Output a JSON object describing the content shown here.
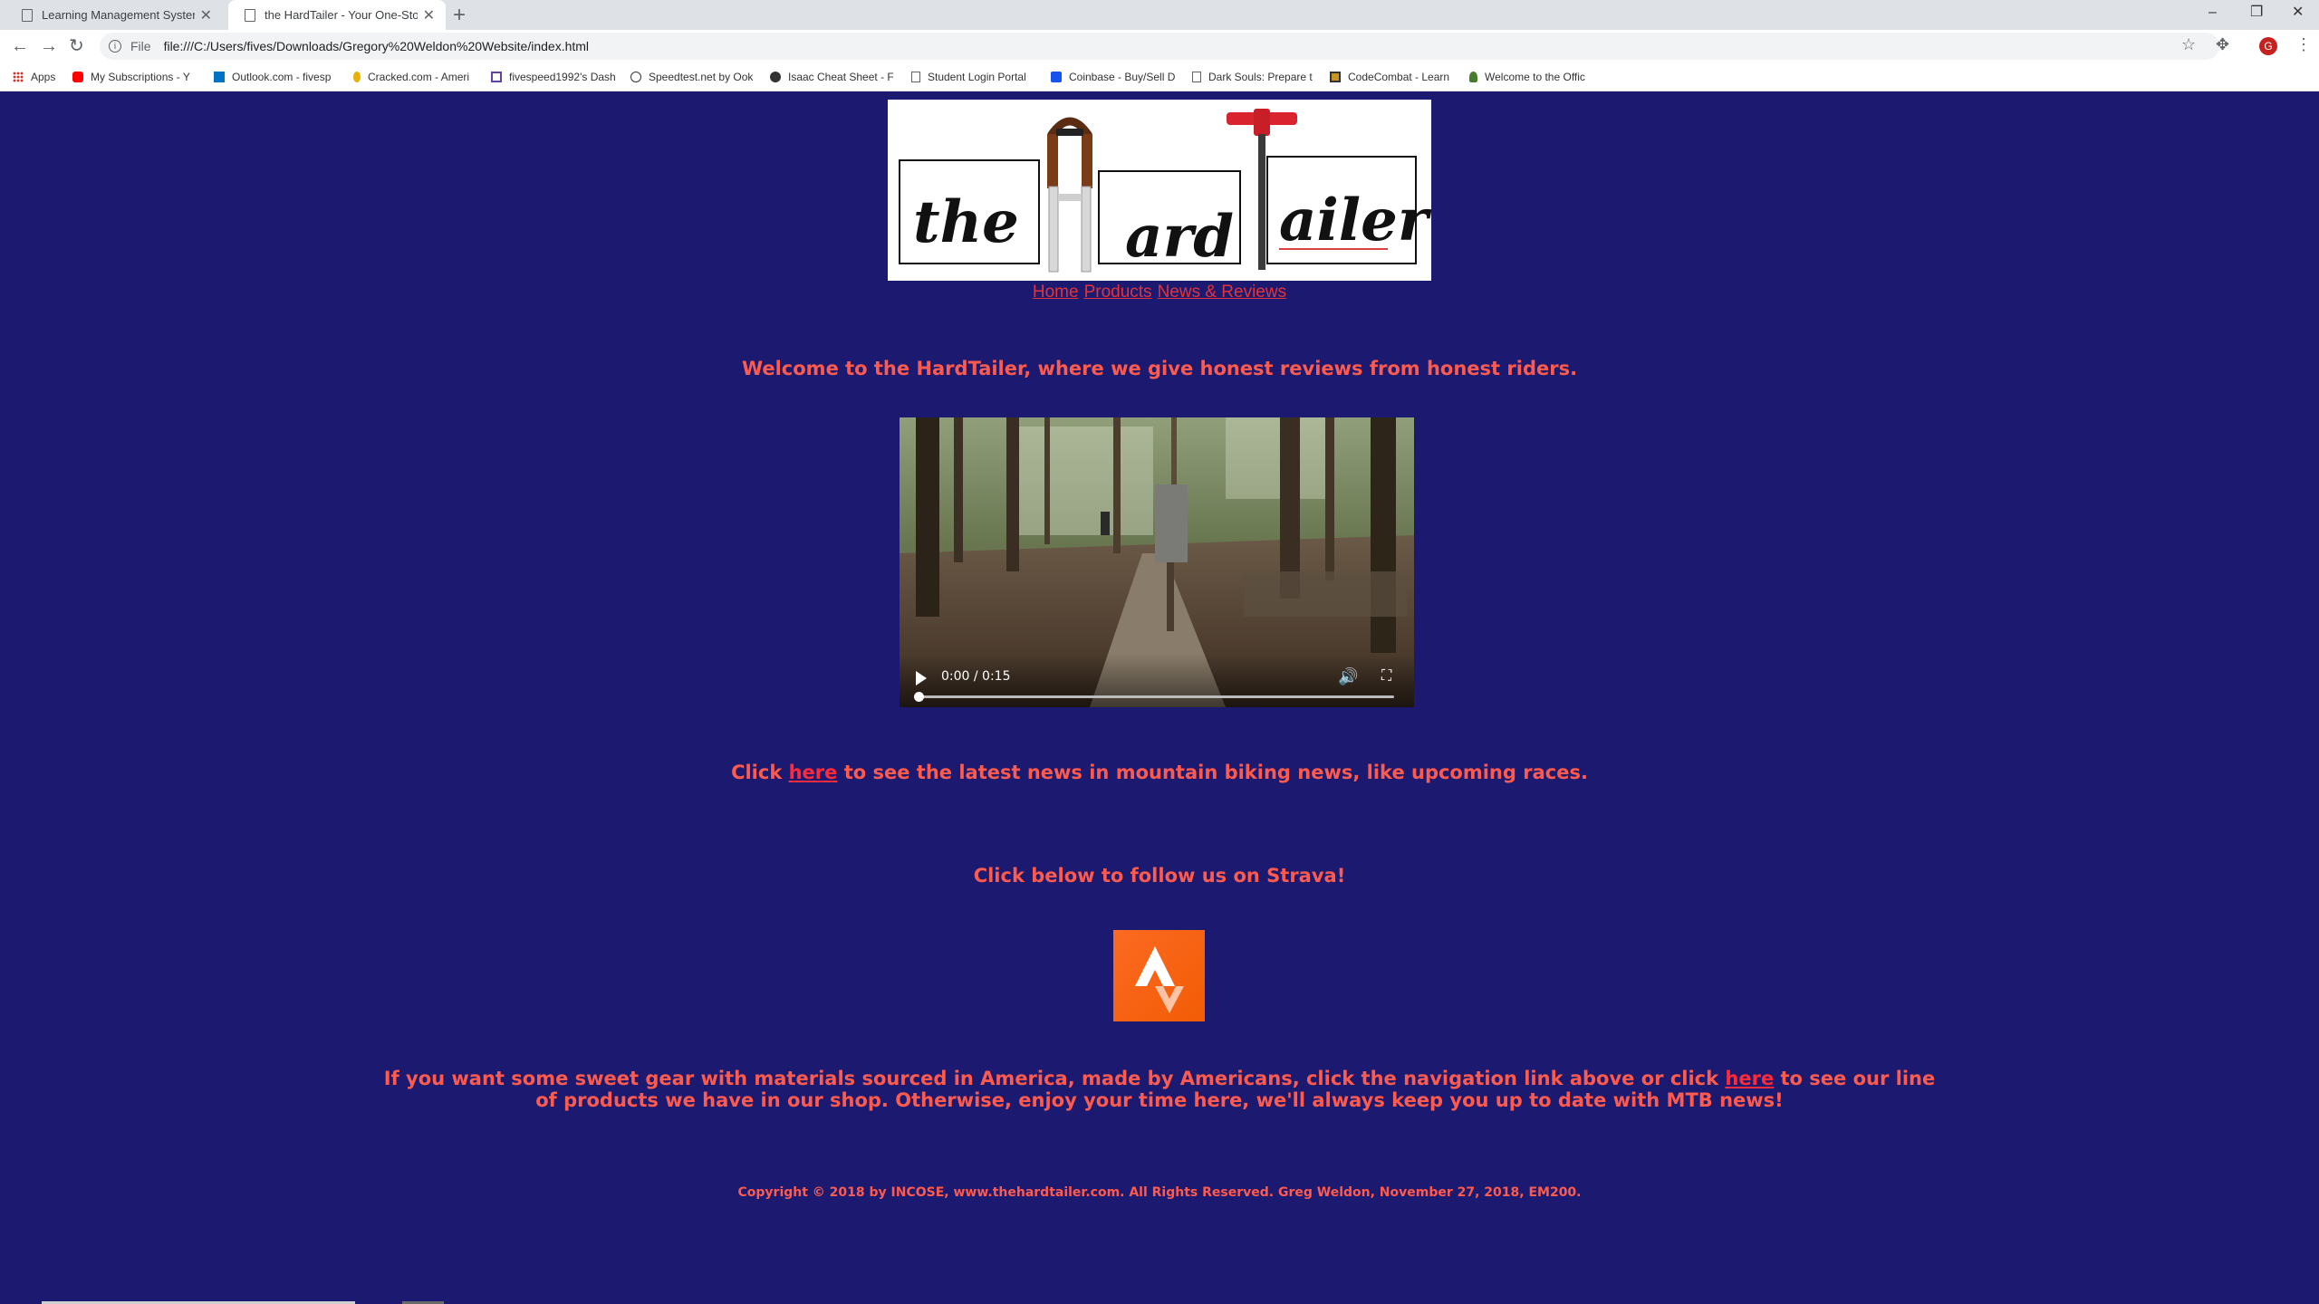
{
  "browser": {
    "tabs": [
      {
        "title": "Learning Management System",
        "active": false
      },
      {
        "title": "the HardTailer - Your One-Stop S",
        "active": true
      }
    ],
    "address": {
      "scheme": "File",
      "url": "file:///C:/Users/fives/Downloads/Gregory%20Weldon%20Website/index.html"
    },
    "profile_initial": "G",
    "bookmarks": [
      {
        "label": "Apps",
        "icon": "apps-grid-icon"
      },
      {
        "label": "My Subscriptions - Y",
        "icon": "youtube-icon"
      },
      {
        "label": "Outlook.com - fivesp",
        "icon": "outlook-icon"
      },
      {
        "label": "Cracked.com - Ameri",
        "icon": "cracked-icon"
      },
      {
        "label": "fivespeed1992's Dash",
        "icon": "twitch-icon"
      },
      {
        "label": "Speedtest.net by Ook",
        "icon": "speedtest-icon"
      },
      {
        "label": "Isaac Cheat Sheet - F",
        "icon": "isaac-icon"
      },
      {
        "label": "Student Login Portal",
        "icon": "page-icon"
      },
      {
        "label": "Coinbase - Buy/Sell D",
        "icon": "coinbase-icon"
      },
      {
        "label": "Dark Souls: Prepare t",
        "icon": "page-icon"
      },
      {
        "label": "CodeCombat - Learn",
        "icon": "codecombat-icon"
      },
      {
        "label": "Welcome to the Offic",
        "icon": "fallout-icon"
      }
    ]
  },
  "logo": {
    "words": [
      "the",
      "ard",
      "ailer"
    ]
  },
  "nav": {
    "home": "Home",
    "products": "Products",
    "news": "News & Reviews"
  },
  "welcome": "Welcome to the HardTailer, where we give honest reviews from honest riders.",
  "video": {
    "time": "0:00 / 0:15",
    "progress": 0
  },
  "news_line": {
    "prefix": "Click ",
    "link": "here",
    "suffix": " to see the latest news in mountain biking news, like upcoming races."
  },
  "strava_line": "Click below to follow us on Strava!",
  "gear_line": {
    "prefix": "If you want some sweet gear with materials sourced in America, made by Americans, click the navigation link above or click ",
    "link": "here",
    "suffix_line1": " to see our line",
    "line2": "of products we have in our shop. Otherwise, enjoy your time here, we'll always keep you up to date with MTB news!"
  },
  "footer": "Copyright © 2018 by INCOSE, www.thehardtailer.com. All Rights Reserved. Greg Weldon, November 27, 2018, EM200.",
  "colors": {
    "page_background": "#1b1a70",
    "text": "#ff5a4e",
    "link": "#ff2b3a",
    "strava": "#fc5200"
  }
}
